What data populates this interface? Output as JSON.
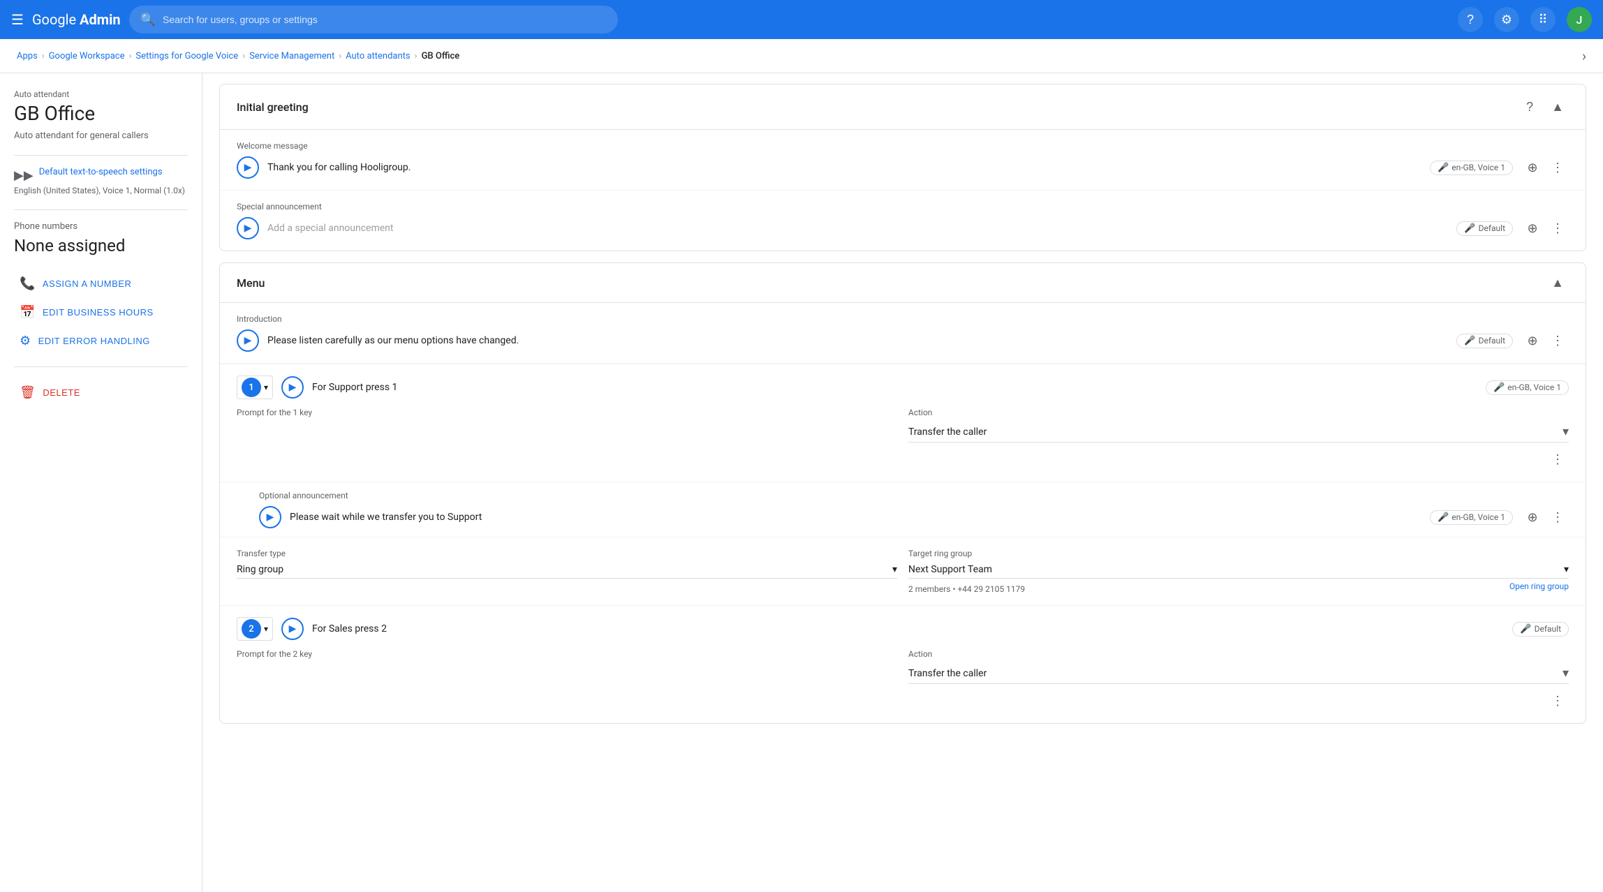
{
  "nav": {
    "menu_icon": "☰",
    "logo": "Google Admin",
    "search_placeholder": "Search for users, groups or settings",
    "help_badge": "?",
    "avatar_letter": "J"
  },
  "breadcrumb": {
    "items": [
      {
        "label": "Apps",
        "link": true
      },
      {
        "label": "Google Workspace",
        "link": true
      },
      {
        "label": "Settings for Google Voice",
        "link": true
      },
      {
        "label": "Service Management",
        "link": true
      },
      {
        "label": "Auto attendants",
        "link": true
      },
      {
        "label": "GB Office",
        "link": false
      }
    ]
  },
  "sidebar": {
    "auto_attendant_label": "Auto attendant",
    "title": "GB Office",
    "description": "Auto attendant for general callers",
    "tts_label": "Default text-to-speech settings",
    "tts_desc": "English (United States), Voice 1, Normal (1.0x)",
    "phone_numbers_label": "Phone numbers",
    "phone_none": "None assigned",
    "assign_btn": "ASSIGN A NUMBER",
    "edit_hours_btn": "EDIT BUSINESS HOURS",
    "edit_error_btn": "EDIT ERROR HANDLING",
    "delete_btn": "DELETE"
  },
  "initial_greeting": {
    "section_title": "Initial greeting",
    "welcome_label": "Welcome message",
    "welcome_text": "Thank you for calling Hooligroup.",
    "welcome_voice": "en-GB, Voice 1",
    "special_label": "Special announcement",
    "special_placeholder": "Add a special announcement",
    "special_voice": "Default"
  },
  "menu": {
    "section_title": "Menu",
    "intro_label": "Introduction",
    "intro_text": "Please listen carefully as our menu options have changed.",
    "intro_voice": "Default",
    "key1": {
      "number": "1",
      "prompt_label": "Prompt for the 1 key",
      "prompt_text": "For Support press 1",
      "voice": "en-GB, Voice 1",
      "action_label": "Action",
      "action_value": "Transfer the caller",
      "opt_label": "Optional announcement",
      "opt_text": "Please wait while we transfer you to Support",
      "opt_voice": "en-GB, Voice 1",
      "transfer_type_label": "Transfer type",
      "transfer_type": "Ring group",
      "target_label": "Target ring group",
      "target_value": "Next Support Team",
      "ring_info": "2 members • +44 29 2105 1179",
      "open_ring": "Open ring group"
    },
    "key2": {
      "number": "2",
      "prompt_label": "Prompt for the 2 key",
      "prompt_text": "For Sales press 2",
      "voice": "Default",
      "action_label": "Action",
      "action_value": "Transfer the caller"
    }
  },
  "icons": {
    "play": "▶",
    "mic": "🎤",
    "add": "+",
    "more": "⋮",
    "chevron_up": "▲",
    "chevron_down": "▾",
    "phone": "📞",
    "calendar": "📅",
    "edit_routing": "⚙",
    "trash": "🗑",
    "search": "🔍",
    "apps_grid": "⋮⋮",
    "help": "?",
    "tts": "▶▶"
  }
}
